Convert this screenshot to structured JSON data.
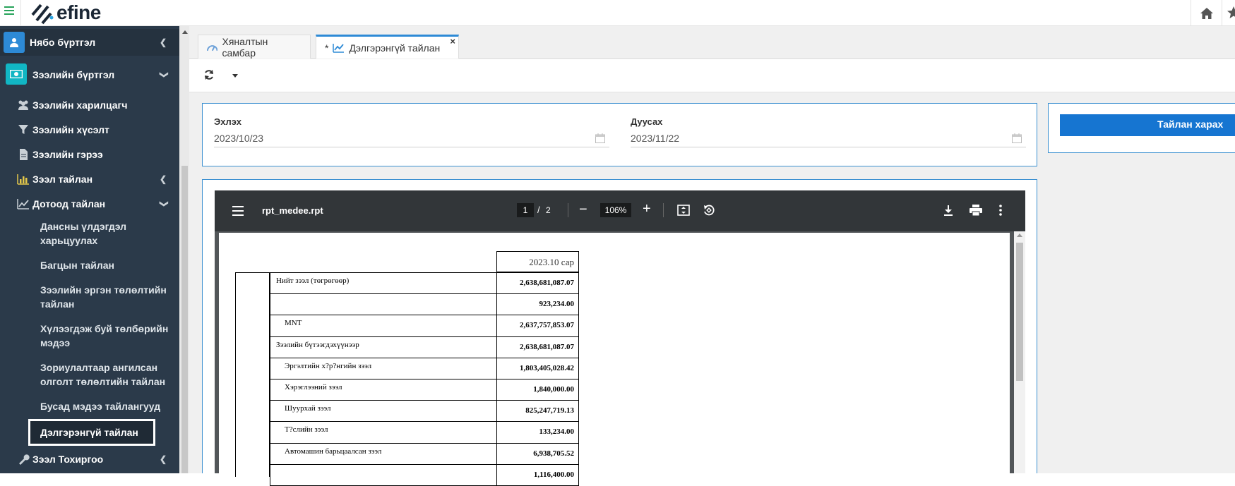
{
  "app": {
    "logo_text": "efine"
  },
  "sidebar": {
    "items": [
      {
        "label": "Нябо бүртгэл"
      },
      {
        "label": "Зээлийн бүртгэл"
      },
      {
        "label": "Зээлийн харилцагч"
      },
      {
        "label": "Зээлийн хүсэлт"
      },
      {
        "label": "Зээлийн гэрээ"
      },
      {
        "label": "Зээл тайлан"
      },
      {
        "label": "Дотоод тайлан"
      },
      {
        "label": "Дансны үлдэгдэл харьцуулах"
      },
      {
        "label": "Багцын тайлан"
      },
      {
        "label": "Зээлийн эргэн төлөлтийн тайлан"
      },
      {
        "label": "Хүлээгдэж буй төлбөрийн мэдээ"
      },
      {
        "label": "Зориулалтаар ангилсан олголт төлөлтийн тайлан"
      },
      {
        "label": "Бусад мэдээ тайлангууд"
      },
      {
        "label": "Дэлгэрэнгүй тайлан"
      },
      {
        "label": "Зээл Тохиргоо"
      }
    ]
  },
  "tabs": [
    {
      "label": "Хяналтын самбар"
    },
    {
      "label": "Дэлгэрэнгүй тайлан",
      "modified_marker": "*",
      "close": "×"
    }
  ],
  "filters": {
    "start_label": "Эхлэх",
    "start_value": "2023/10/23",
    "end_label": "Дуусах",
    "end_value": "2023/11/22",
    "report_button": "Тайлан харах"
  },
  "pdf": {
    "filename": "rpt_medee.rpt",
    "current_page": "1",
    "separator": "/",
    "total_pages": "2",
    "zoom": "106%"
  },
  "report": {
    "header": "2023.10 сар",
    "rows": [
      {
        "label": "Нийт зээл (төгрөгөөр)",
        "value": "2,638,681,087.07"
      },
      {
        "label": "",
        "value": "923,234.00"
      },
      {
        "label": "MNT",
        "value": "2,637,757,853.07"
      },
      {
        "label": "Зээлийн бүтээгдэхүүнээр",
        "value": "2,638,681,087.07"
      },
      {
        "label": "Эргэлтийн х?р?нгийн зээл",
        "value": "1,803,405,028.42"
      },
      {
        "label": "Хэрэглээний зээл",
        "value": "1,840,000.00"
      },
      {
        "label": "Шуурхай зээл",
        "value": "825,247,719.13"
      },
      {
        "label": "Т?слийн зээл",
        "value": "133,234.00"
      },
      {
        "label": "Автомашин барьцаалсан зээл",
        "value": "6,938,705.52"
      },
      {
        "label": "",
        "value": "1,116,400.00"
      }
    ]
  },
  "colors": {
    "sidebar_bg": "#2b3a4a",
    "accent": "#1675d1",
    "pdf_toolbar": "#323639"
  }
}
